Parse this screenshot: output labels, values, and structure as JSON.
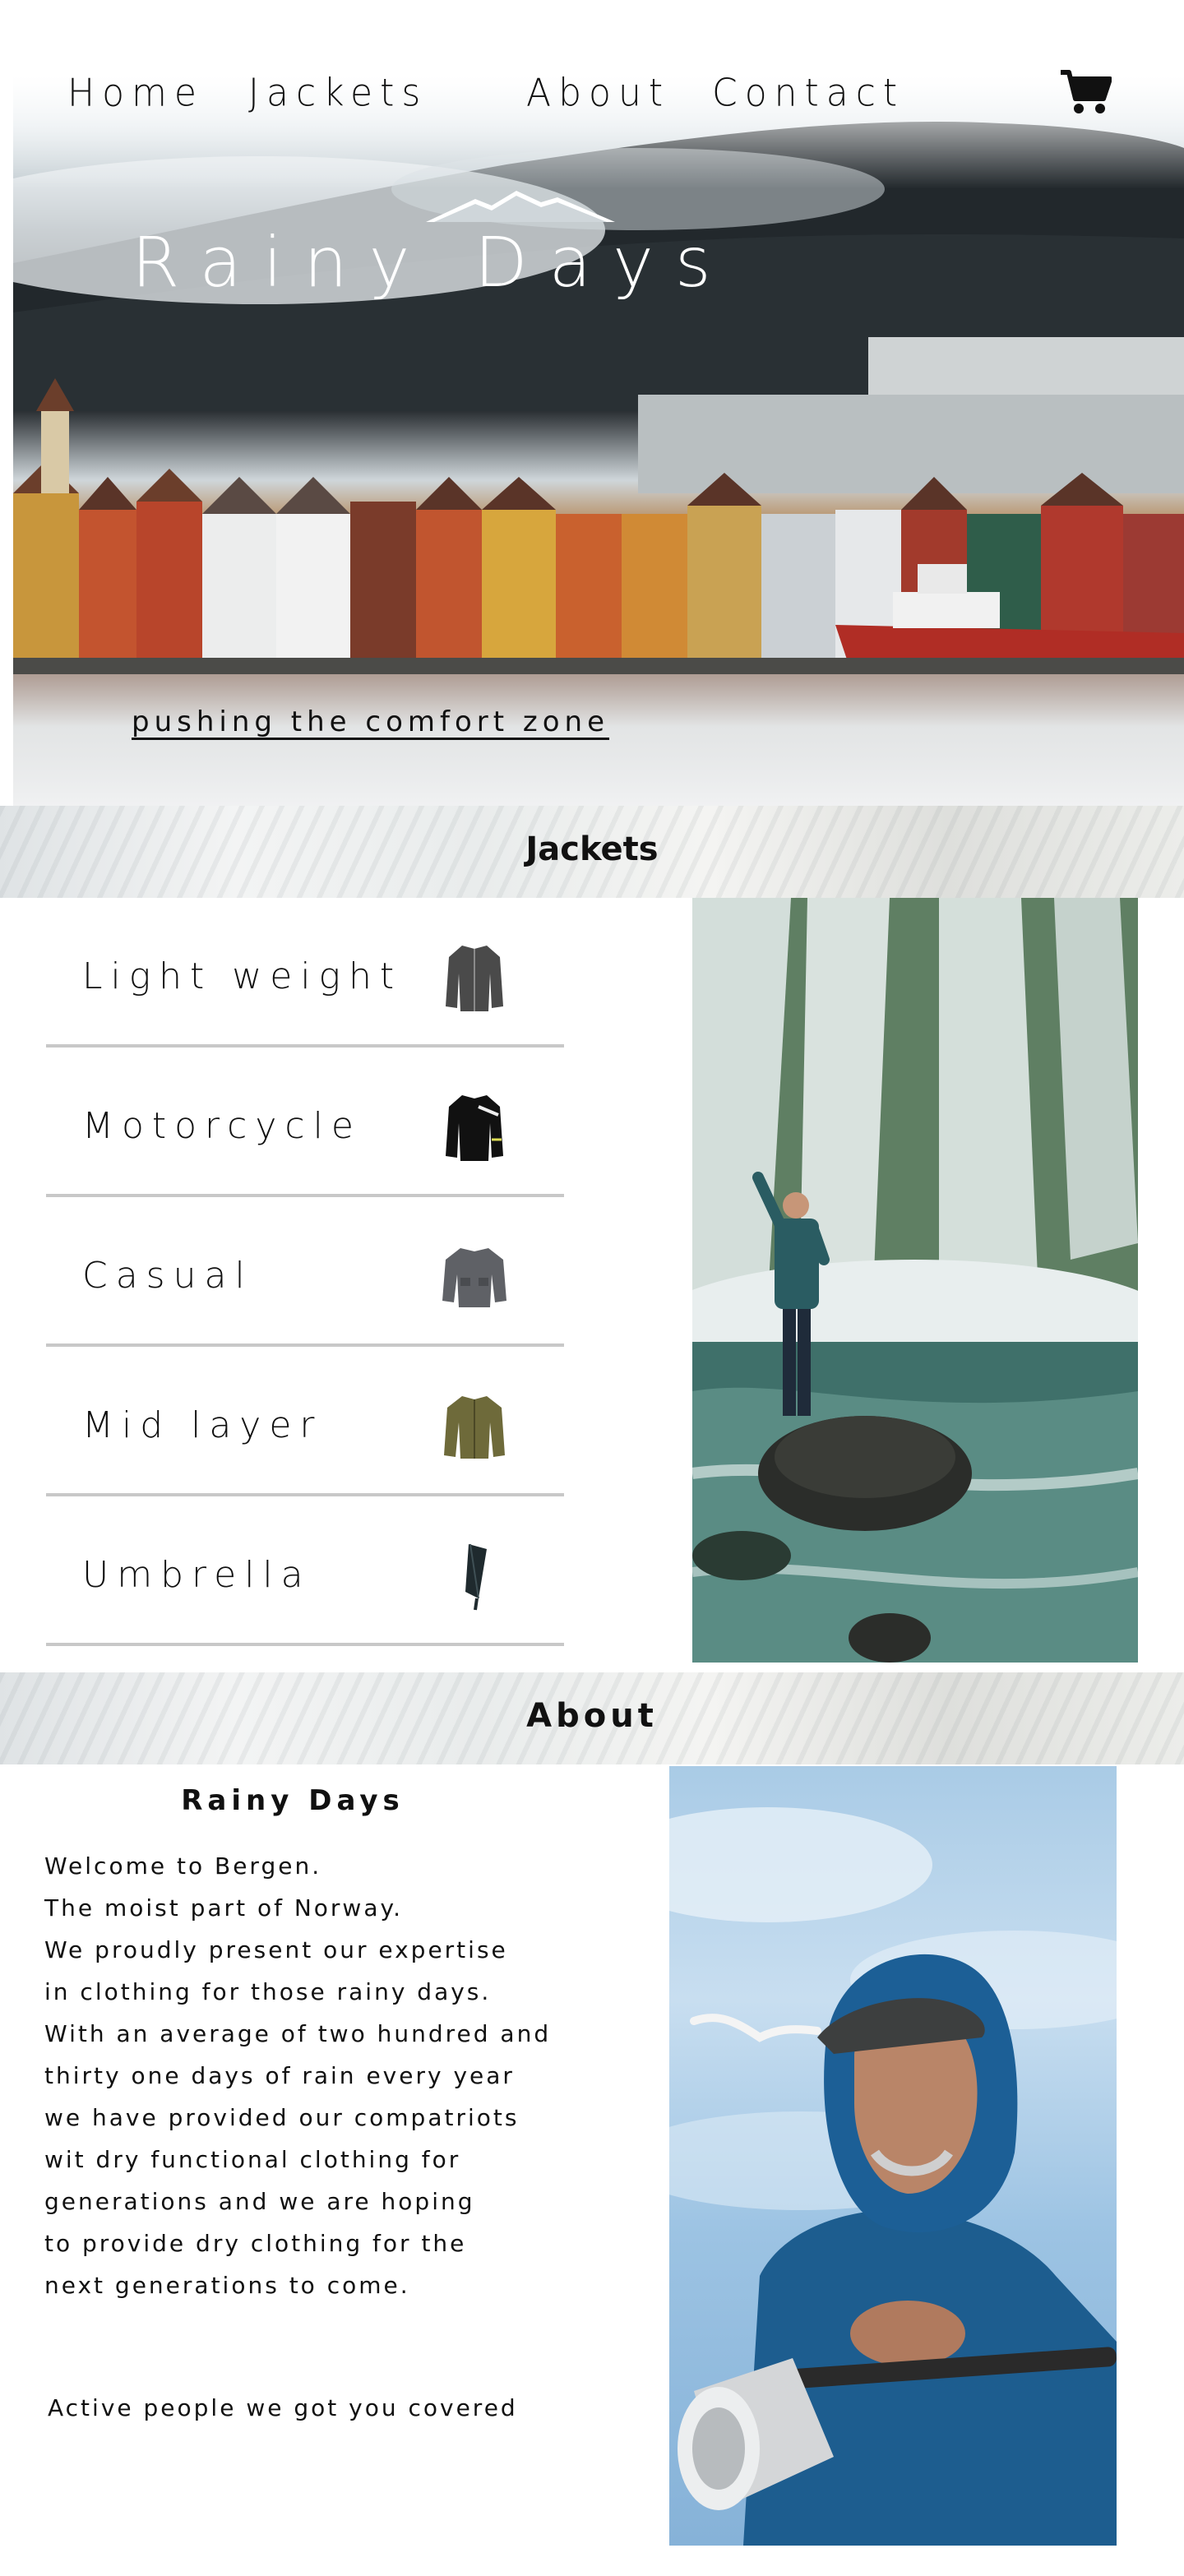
{
  "nav": {
    "links": [
      "Home",
      "Jackets",
      "About",
      "Contact"
    ],
    "cart_icon": "shopping-cart-icon"
  },
  "hero": {
    "brand": "Rainy Days",
    "tagline": "pushing the comfort zone"
  },
  "jackets": {
    "title": "Jackets",
    "items": [
      {
        "label": "Light weight",
        "icon": "light-jacket-icon",
        "color": "#4a4a4a"
      },
      {
        "label": "Motorcycle",
        "icon": "motorcycle-jacket-icon",
        "color": "#111111"
      },
      {
        "label": "Casual",
        "icon": "casual-jacket-icon",
        "color": "#5f6166"
      },
      {
        "label": "Mid layer",
        "icon": "mid-layer-jacket-icon",
        "color": "#6e6a3a"
      },
      {
        "label": "Umbrella",
        "icon": "umbrella-icon",
        "color": "#1f2a2e"
      }
    ]
  },
  "about": {
    "title": "About",
    "heading": "Rainy Days",
    "lines": [
      "Welcome to Bergen.",
      "The moist part of Norway.",
      "We proudly present our expertise",
      "in clothing for those rainy days.",
      "With an average of two hundred and",
      "thirty one days of rain every year",
      "we have provided our compatriots",
      "wit dry functional clothing for",
      "generations and we are hoping",
      "to provide dry clothing for the",
      "next generations to come."
    ],
    "closing": "Active people we got you covered"
  },
  "colors": {
    "text": "#111111",
    "divider": "#c8c8c8",
    "background": "#ffffff"
  }
}
